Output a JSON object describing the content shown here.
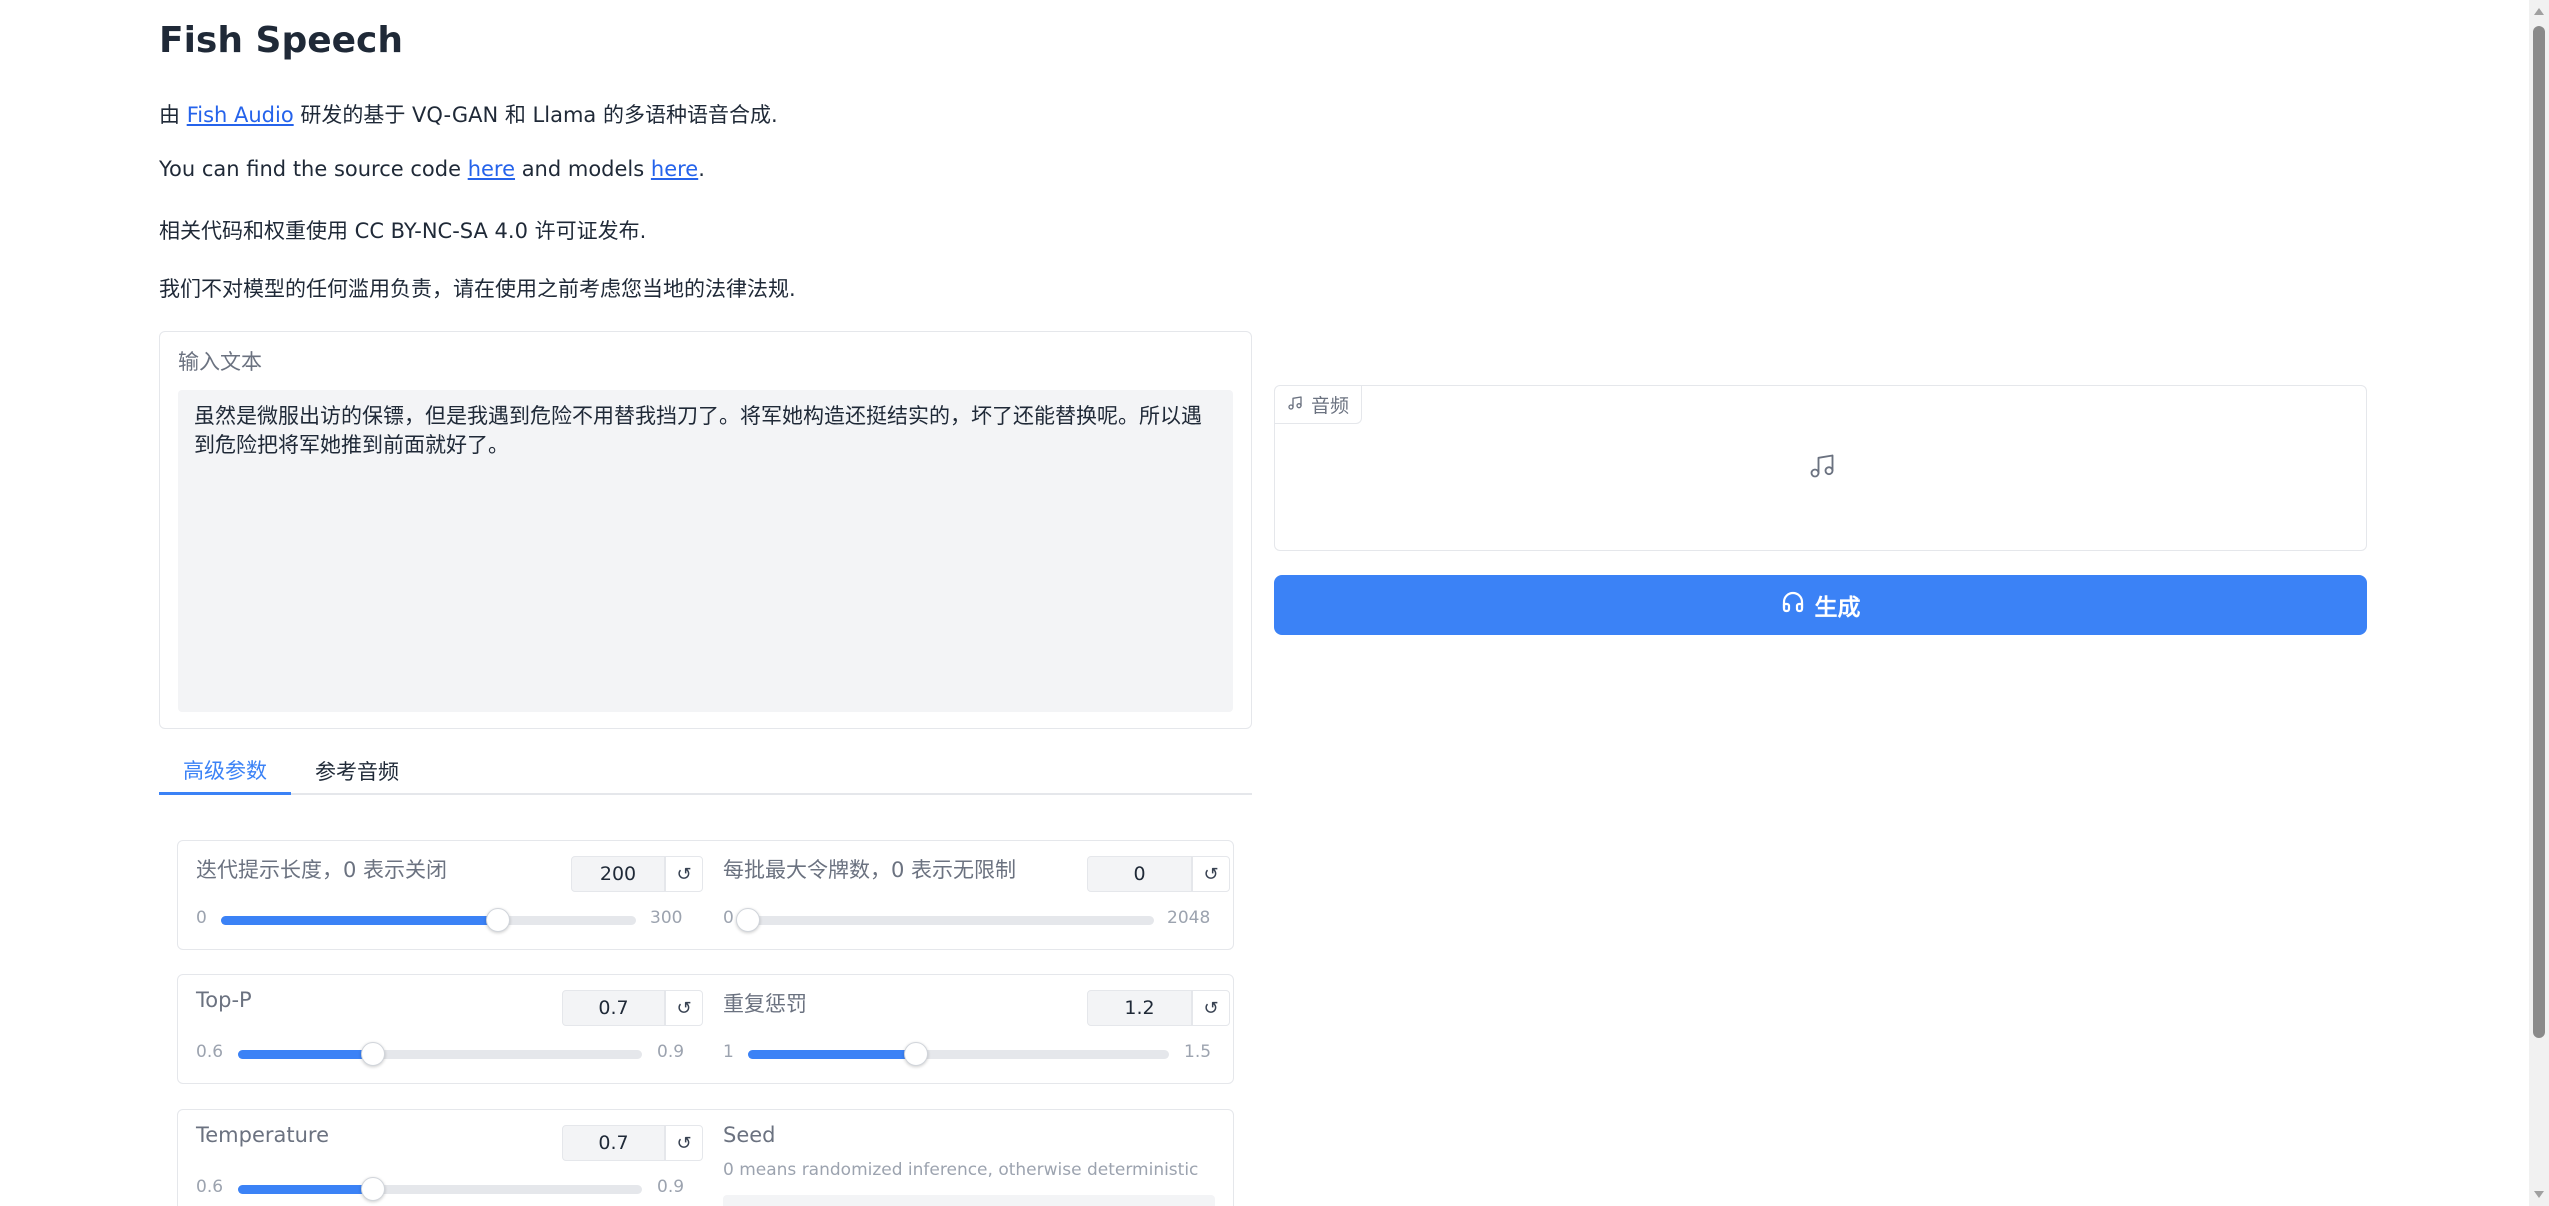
{
  "header": {
    "title": "Fish Speech",
    "intro_prefix": "由 ",
    "intro_link": "Fish Audio",
    "intro_suffix": " 研发的基于 VQ-GAN 和 Llama 的多语种语音合成.",
    "source_prefix": "You can find the source code ",
    "source_link": "here",
    "source_middle": " and models ",
    "models_link": "here",
    "source_suffix": ".",
    "license": "相关代码和权重使用 CC BY-NC-SA 4.0 许可证发布.",
    "disclaimer": "我们不对模型的任何滥用负责，请在使用之前考虑您当地的法律法规."
  },
  "input": {
    "label": "输入文本",
    "value": "虽然是微服出访的保镖，但是我遇到危险不用替我挡刀了。将军她构造还挺结实的，坏了还能替换呢。所以遇到危险把将军她推到前面就好了。"
  },
  "audio": {
    "label": "音频",
    "icon": "music-note-icon"
  },
  "generate": {
    "label": "生成",
    "icon": "headphones-icon"
  },
  "tabs": [
    {
      "label": "高级参数",
      "active": true
    },
    {
      "label": "参考音频",
      "active": false
    }
  ],
  "params": {
    "iter_prompt_length": {
      "label": "迭代提示长度，0 表示关闭",
      "value": "200",
      "min": "0",
      "max": "300",
      "fraction": 0.667
    },
    "max_new_tokens": {
      "label": "每批最大令牌数，0 表示无限制",
      "value": "0",
      "min": "0",
      "max": "2048",
      "fraction": 0.0
    },
    "top_p": {
      "label": "Top-P",
      "value": "0.7",
      "min": "0.6",
      "max": "0.9",
      "fraction": 0.333
    },
    "repetition_penalty": {
      "label": "重复惩罚",
      "value": "1.2",
      "min": "1",
      "max": "1.5",
      "fraction": 0.4
    },
    "temperature": {
      "label": "Temperature",
      "value": "0.7",
      "min": "0.6",
      "max": "0.9",
      "fraction": 0.333
    },
    "seed": {
      "label": "Seed",
      "description": "0 means randomized inference, otherwise deterministic"
    }
  },
  "colors": {
    "accent": "#3b82f6",
    "link": "#2563eb"
  }
}
